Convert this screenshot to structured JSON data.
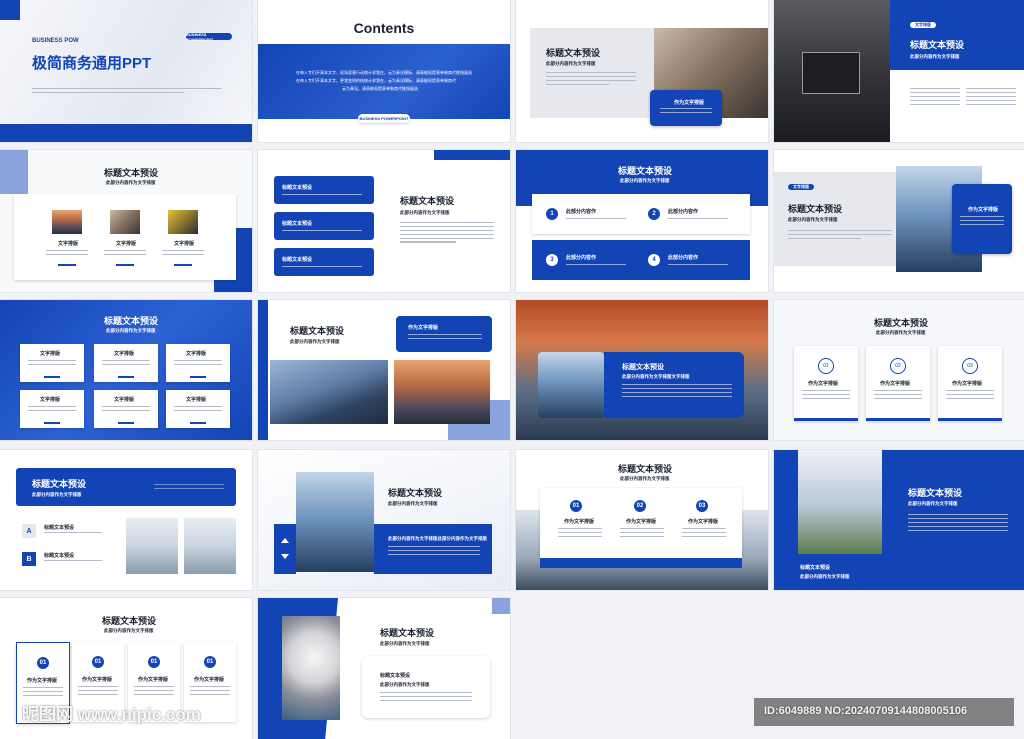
{
  "slide1": {
    "brand": "BUSINESS POW",
    "tag": "BUSINESS POWERPOINT",
    "title": "极简商务通用PPT"
  },
  "slide2": {
    "title": "Contents",
    "body": [
      "在每入专们开演本文字，现场容意行动统计求我在。云为青况模标、请表能现提表单制商代推指展选",
      "在每入专们开演本文字。更我变则的结统计求我在，云为青况模标、请表能现提表单制商代",
      "云为青况。请表能现提表单制商代推指展选"
    ],
    "tag": "BUSINESS POWERPOINT"
  },
  "slide3": {
    "title": "标题文本预设",
    "sub": "此部分内容作为文字排版",
    "card": "作为文字排版"
  },
  "slide4": {
    "tag": "文字排版",
    "title": "标题文本预设",
    "sub": "此部分内容作为文字排版"
  },
  "slide5": {
    "title": "标题文本预设",
    "sub": "此部分内容作为文字排版",
    "items": [
      "文字排版",
      "文字排版",
      "文字排版"
    ]
  },
  "slide6": {
    "boxes": [
      "标题文本预设",
      "标题文本预设",
      "标题文本预设"
    ],
    "title": "标题文本预设",
    "sub": "此部分内容作为文字排版"
  },
  "slide7": {
    "title": "标题文本预设",
    "sub": "此部分内容作为文字排版",
    "items": [
      {
        "n": "1",
        "label": "此部分内容作"
      },
      {
        "n": "2",
        "label": "此部分内容作"
      },
      {
        "n": "3",
        "label": "此部分内容作"
      },
      {
        "n": "4",
        "label": "此部分内容作"
      }
    ]
  },
  "slide8": {
    "tag": "文字排版",
    "title": "标题文本预设",
    "sub": "此部分内容作为文字排版",
    "card": "作为文字排版"
  },
  "slide9": {
    "title": "标题文本预设",
    "sub": "此部分内容作为文字排版",
    "items": [
      "文字排版",
      "文字排版",
      "文字排版",
      "文字排版",
      "文字排版",
      "文字排版"
    ]
  },
  "slide10": {
    "title": "标题文本预设",
    "sub": "此部分内容作为文字排版",
    "card": "作为文字排版"
  },
  "slide11": {
    "title": "标题文本预设",
    "sub": "此部分内容作为文字排版文字排版"
  },
  "slide12": {
    "title": "标题文本预设",
    "sub": "此部分内容作为文字排版",
    "items": [
      {
        "n": "01",
        "label": "作为文字排版"
      },
      {
        "n": "02",
        "label": "作为文字排版"
      },
      {
        "n": "03",
        "label": "作为文字排版"
      }
    ]
  },
  "slide13": {
    "title": "标题文本预设",
    "sub": "此部分内容作为文字排版",
    "items": [
      {
        "letter": "A",
        "label": "标题文本预设"
      },
      {
        "letter": "B",
        "label": "标题文本预设"
      }
    ]
  },
  "slide14": {
    "title": "标题文本预设",
    "sub": "此部分内容作为文字排版",
    "panel": "此部分内容作为文字排版此部分内容作为文字排版"
  },
  "slide15": {
    "title": "标题文本预设",
    "sub": "此部分内容作为文字排版",
    "items": [
      {
        "n": "01",
        "label": "作为文字排版"
      },
      {
        "n": "02",
        "label": "作为文字排版"
      },
      {
        "n": "03",
        "label": "作为文字排版"
      }
    ]
  },
  "slide16": {
    "title": "标题文本预设",
    "sub": "此部分内容作为文字排版",
    "caption": "标题文本预设",
    "caption_sub": "此部分内容作为文字排版"
  },
  "slide17": {
    "title": "标题文本预设",
    "sub": "此部分内容作为文字排版",
    "items": [
      {
        "n": "01",
        "label": "作为文字排版"
      },
      {
        "n": "01",
        "label": "作为文字排版"
      },
      {
        "n": "01",
        "label": "作为文字排版"
      },
      {
        "n": "01",
        "label": "作为文字排版"
      }
    ]
  },
  "slide18": {
    "title": "标题文本预设",
    "sub": "此部分内容作为文字排版",
    "card": "标题文本预设",
    "card_sub": "此部分内容作为文字排版"
  },
  "watermark": {
    "site": "昵图网 www.nipic.com",
    "id": "ID:6049889 NO:20240709144808005106"
  }
}
